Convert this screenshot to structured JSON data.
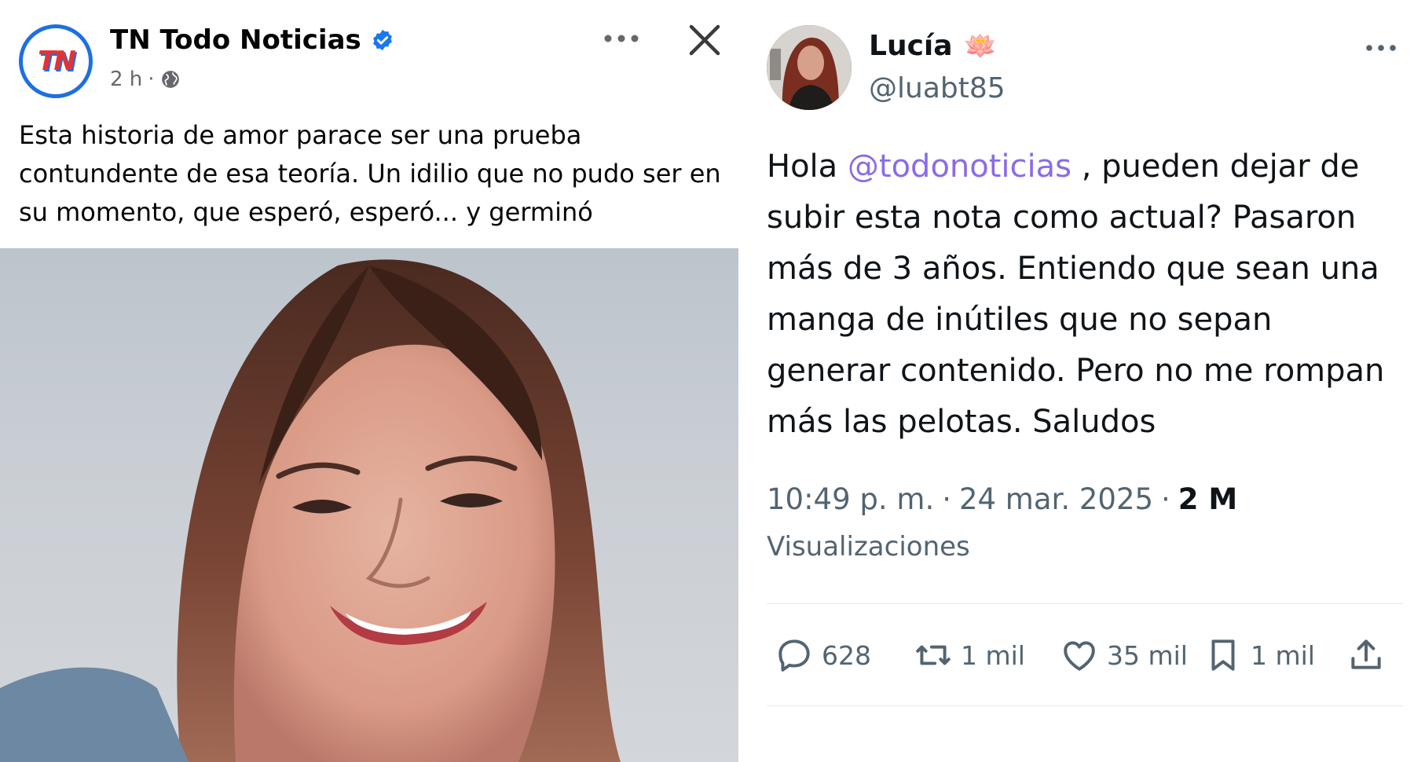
{
  "facebook": {
    "logo_text": "TN",
    "page_name": "TN Todo Noticias",
    "time": "2 h",
    "separator": "·",
    "post_text": "Esta historia de amor parace ser una prueba contundente de esa teoría. Un idilio que no pudo ser en su momento, que esperó, esperó... y germinó",
    "icons": [
      "verified-badge-icon",
      "globe-icon",
      "more-options-icon",
      "close-icon"
    ],
    "colors": {
      "brand_blue": "#1e6fe0",
      "brand_red": "#e53232",
      "text": "#050505",
      "muted": "#65676b"
    }
  },
  "tweet": {
    "name": "Lucía",
    "emoji": "🪷",
    "handle": "@luabt85",
    "text_before": "Hola ",
    "mention": "@todonoticias",
    "text_after": " , pueden dejar de subir esta nota como actual? Pasaron más de 3 años. Entiendo que sean una manga de inútiles que no sepan generar contenido. Pero no me rompan más las pelotas. Saludos",
    "time": "10:49 p. m.",
    "date": "24 mar. 2025",
    "separator": "·",
    "views": "2 M",
    "views_label": "Visualizaciones",
    "stats": {
      "replies": "628",
      "retweets": "1 mil",
      "likes": "35 mil",
      "bookmarks": "1 mil"
    },
    "icons": [
      "more-options-icon",
      "reply-icon",
      "retweet-icon",
      "like-icon",
      "bookmark-icon",
      "share-icon"
    ],
    "colors": {
      "mention": "#8b6be8",
      "text": "#0f1419",
      "muted": "#536471"
    }
  }
}
